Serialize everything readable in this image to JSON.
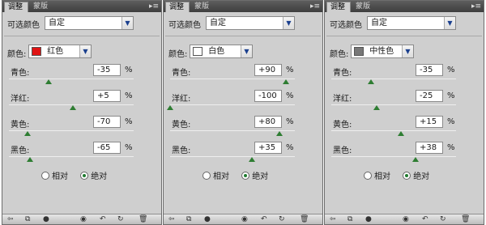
{
  "panels": [
    {
      "tabs": [
        "调整",
        "蒙版"
      ],
      "preset_label": "可选颜色",
      "preset_value": "自定",
      "color_label": "颜色:",
      "color_name": "红色",
      "swatch": "#e01414",
      "rows": [
        {
          "label": "青色:",
          "value": "-35",
          "pct": "%",
          "level": -35
        },
        {
          "label": "洋红:",
          "value": "+5",
          "pct": "%",
          "level": 5
        },
        {
          "label": "黄色:",
          "value": "-70",
          "pct": "%",
          "level": -70
        },
        {
          "label": "黑色:",
          "value": "-65",
          "pct": "%",
          "level": -65
        }
      ],
      "method_relative": "相对",
      "method_absolute": "绝对",
      "method_selected": "absolute"
    },
    {
      "tabs": [
        "调整",
        "蒙版"
      ],
      "preset_label": "可选颜色",
      "preset_value": "自定",
      "color_label": "颜色:",
      "color_name": "白色",
      "swatch": "#ffffff",
      "rows": [
        {
          "label": "青色:",
          "value": "+90",
          "pct": "%",
          "level": 90
        },
        {
          "label": "洋红:",
          "value": "-100",
          "pct": "%",
          "level": -100
        },
        {
          "label": "黄色:",
          "value": "+80",
          "pct": "%",
          "level": 80
        },
        {
          "label": "黑色:",
          "value": "+35",
          "pct": "%",
          "level": 35
        }
      ],
      "method_relative": "相对",
      "method_absolute": "绝对",
      "method_selected": "absolute"
    },
    {
      "tabs": [
        "调整",
        "蒙版"
      ],
      "preset_label": "可选颜色",
      "preset_value": "自定",
      "color_label": "颜色:",
      "color_name": "中性色",
      "swatch": "#777777",
      "rows": [
        {
          "label": "青色:",
          "value": "-35",
          "pct": "%",
          "level": -35
        },
        {
          "label": "洋红:",
          "value": "-25",
          "pct": "%",
          "level": -25
        },
        {
          "label": "黄色:",
          "value": "+15",
          "pct": "%",
          "level": 15
        },
        {
          "label": "黑色:",
          "value": "+38",
          "pct": "%",
          "level": 38
        }
      ],
      "method_relative": "相对",
      "method_absolute": "绝对",
      "method_selected": "absolute"
    }
  ],
  "bottom_icons": [
    "back-arrow-icon",
    "panel-expand-icon",
    "clip-layer-icon",
    "visibility-eye-icon",
    "reset-previous-icon",
    "reset-icon",
    "trash-icon"
  ]
}
